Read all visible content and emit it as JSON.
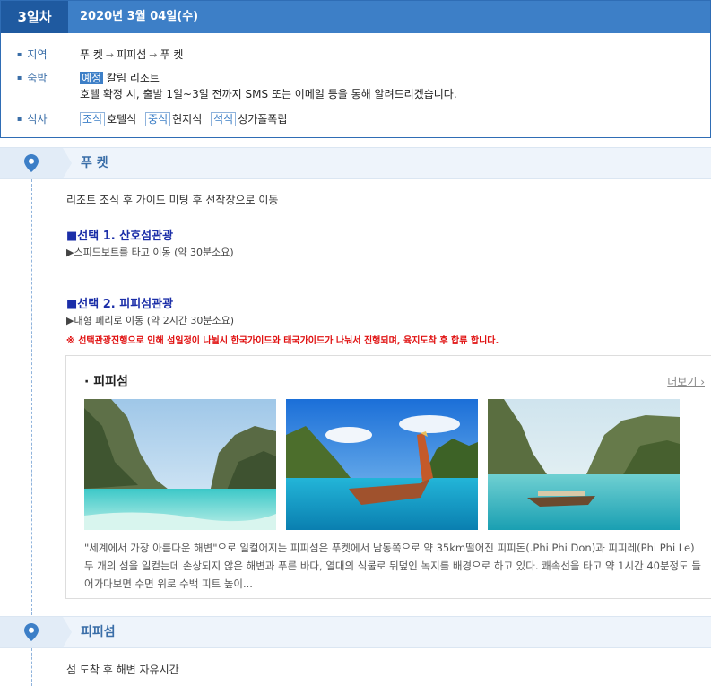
{
  "day": {
    "label": "3일차",
    "date": "2020년 3월 04일(수)"
  },
  "info": {
    "region_label": "지역",
    "region_stops": [
      "푸 켓",
      "피피섬",
      "푸 켓"
    ],
    "lodging_label": "숙박",
    "lodging_tag": "예정",
    "lodging_name": "칼림 리조트",
    "lodging_note": "호텔 확정 시, 출발 1일~3일 전까지 SMS 또는 이메일 등을 통해 알려드리겠습니다.",
    "meal_label": "식사",
    "meals": [
      {
        "tag": "조식",
        "value": "호텔식"
      },
      {
        "tag": "중식",
        "value": "현지식"
      },
      {
        "tag": "석식",
        "value": "싱가폴폭립"
      }
    ]
  },
  "places": [
    {
      "name": "푸 켓"
    },
    {
      "name": "피피섬"
    }
  ],
  "schedule": {
    "intro": "리조트 조식 후 가이드 미팅 후 선착장으로 이동",
    "option1_title": "■선택 1. 산호섬관광",
    "option1_desc": "▶스피드보트를 타고 이동 (약 30분소요)",
    "option2_title": "■선택 2. 피피섬관광",
    "option2_desc": "▶대형 페리로 이동 (약 2시간 30분소요)",
    "warning": "※ 선택관광진행으로 인해 섬일정이 나뉠시 한국가이드와 태국가이드가 나눠서 진행되며, 육지도착 후 합류 합니다.",
    "after_arrival": "섬 도착 후 해변 자유시간"
  },
  "card": {
    "title": "· 피피섬",
    "more_label": "더보기 ›",
    "description": "\"세계에서 가장 아름다운 해변\"으로 일컬어지는 피피섬은 푸켓에서 남동쪽으로 약 35km떨어진 피피돈(.Phi Phi Don)과 피피레(Phi Phi Le) 두 개의 섬을 일컫는데 손상되지 않은 해변과 푸른 바다, 열대의 식물로 뒤덮인 녹지를 배경으로 하고 있다. 쾌속선을 타고 약 1시간 40분정도 들어가다보면 수면 위로 수백 피트 높이..."
  },
  "colors": {
    "primary": "#3d7fc7",
    "primary_dark": "#1f5aa0",
    "option_title": "#1b2ea8",
    "warning": "#e01010"
  }
}
